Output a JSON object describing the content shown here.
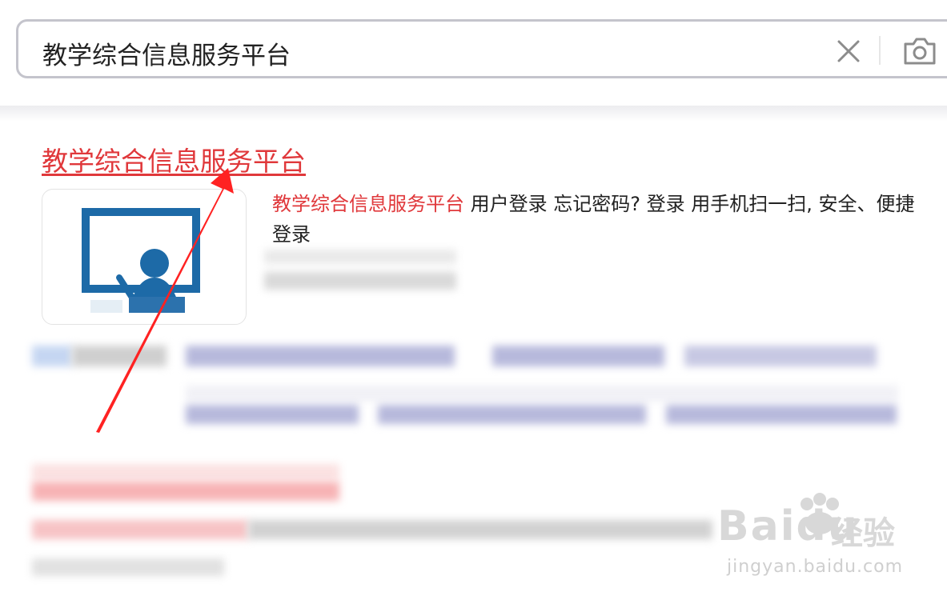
{
  "search": {
    "query": "教学综合信息服务平台"
  },
  "result": {
    "title": "教学综合信息服务平台",
    "snippet_highlight": "教学综合信息服务平台",
    "snippet_rest": " 用户登录 忘记密码? 登录 用手机扫一扫, 安全、便捷登录"
  },
  "colors": {
    "link": "#e0383b",
    "thumb_blue": "#1d6aa7"
  },
  "icons": {
    "clear": "close-icon",
    "camera": "camera-icon"
  },
  "watermark": {
    "text": "Baidu",
    "cn": "经验",
    "url": "jingyan.baidu.com"
  }
}
